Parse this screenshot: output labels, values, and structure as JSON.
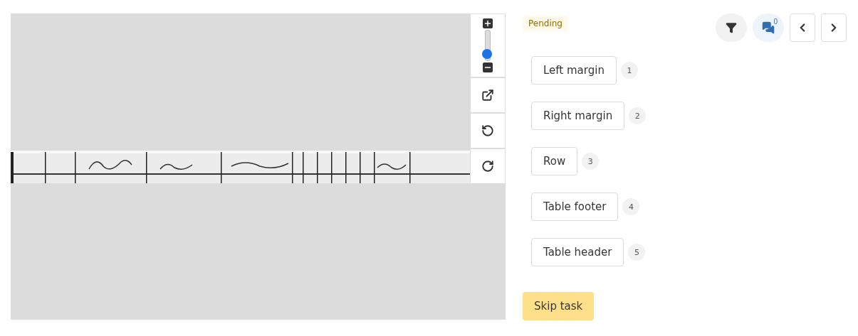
{
  "status": {
    "label": "Pending"
  },
  "viewer": {
    "zoom": {
      "level": 0.22
    }
  },
  "comments": {
    "count": "0"
  },
  "labels": [
    {
      "label": "Left margin",
      "shortcut": "1"
    },
    {
      "label": "Right margin",
      "shortcut": "2"
    },
    {
      "label": "Row",
      "shortcut": "3"
    },
    {
      "label": "Table footer",
      "shortcut": "4"
    },
    {
      "label": "Table header",
      "shortcut": "5"
    }
  ],
  "skip_button": "Skip task"
}
